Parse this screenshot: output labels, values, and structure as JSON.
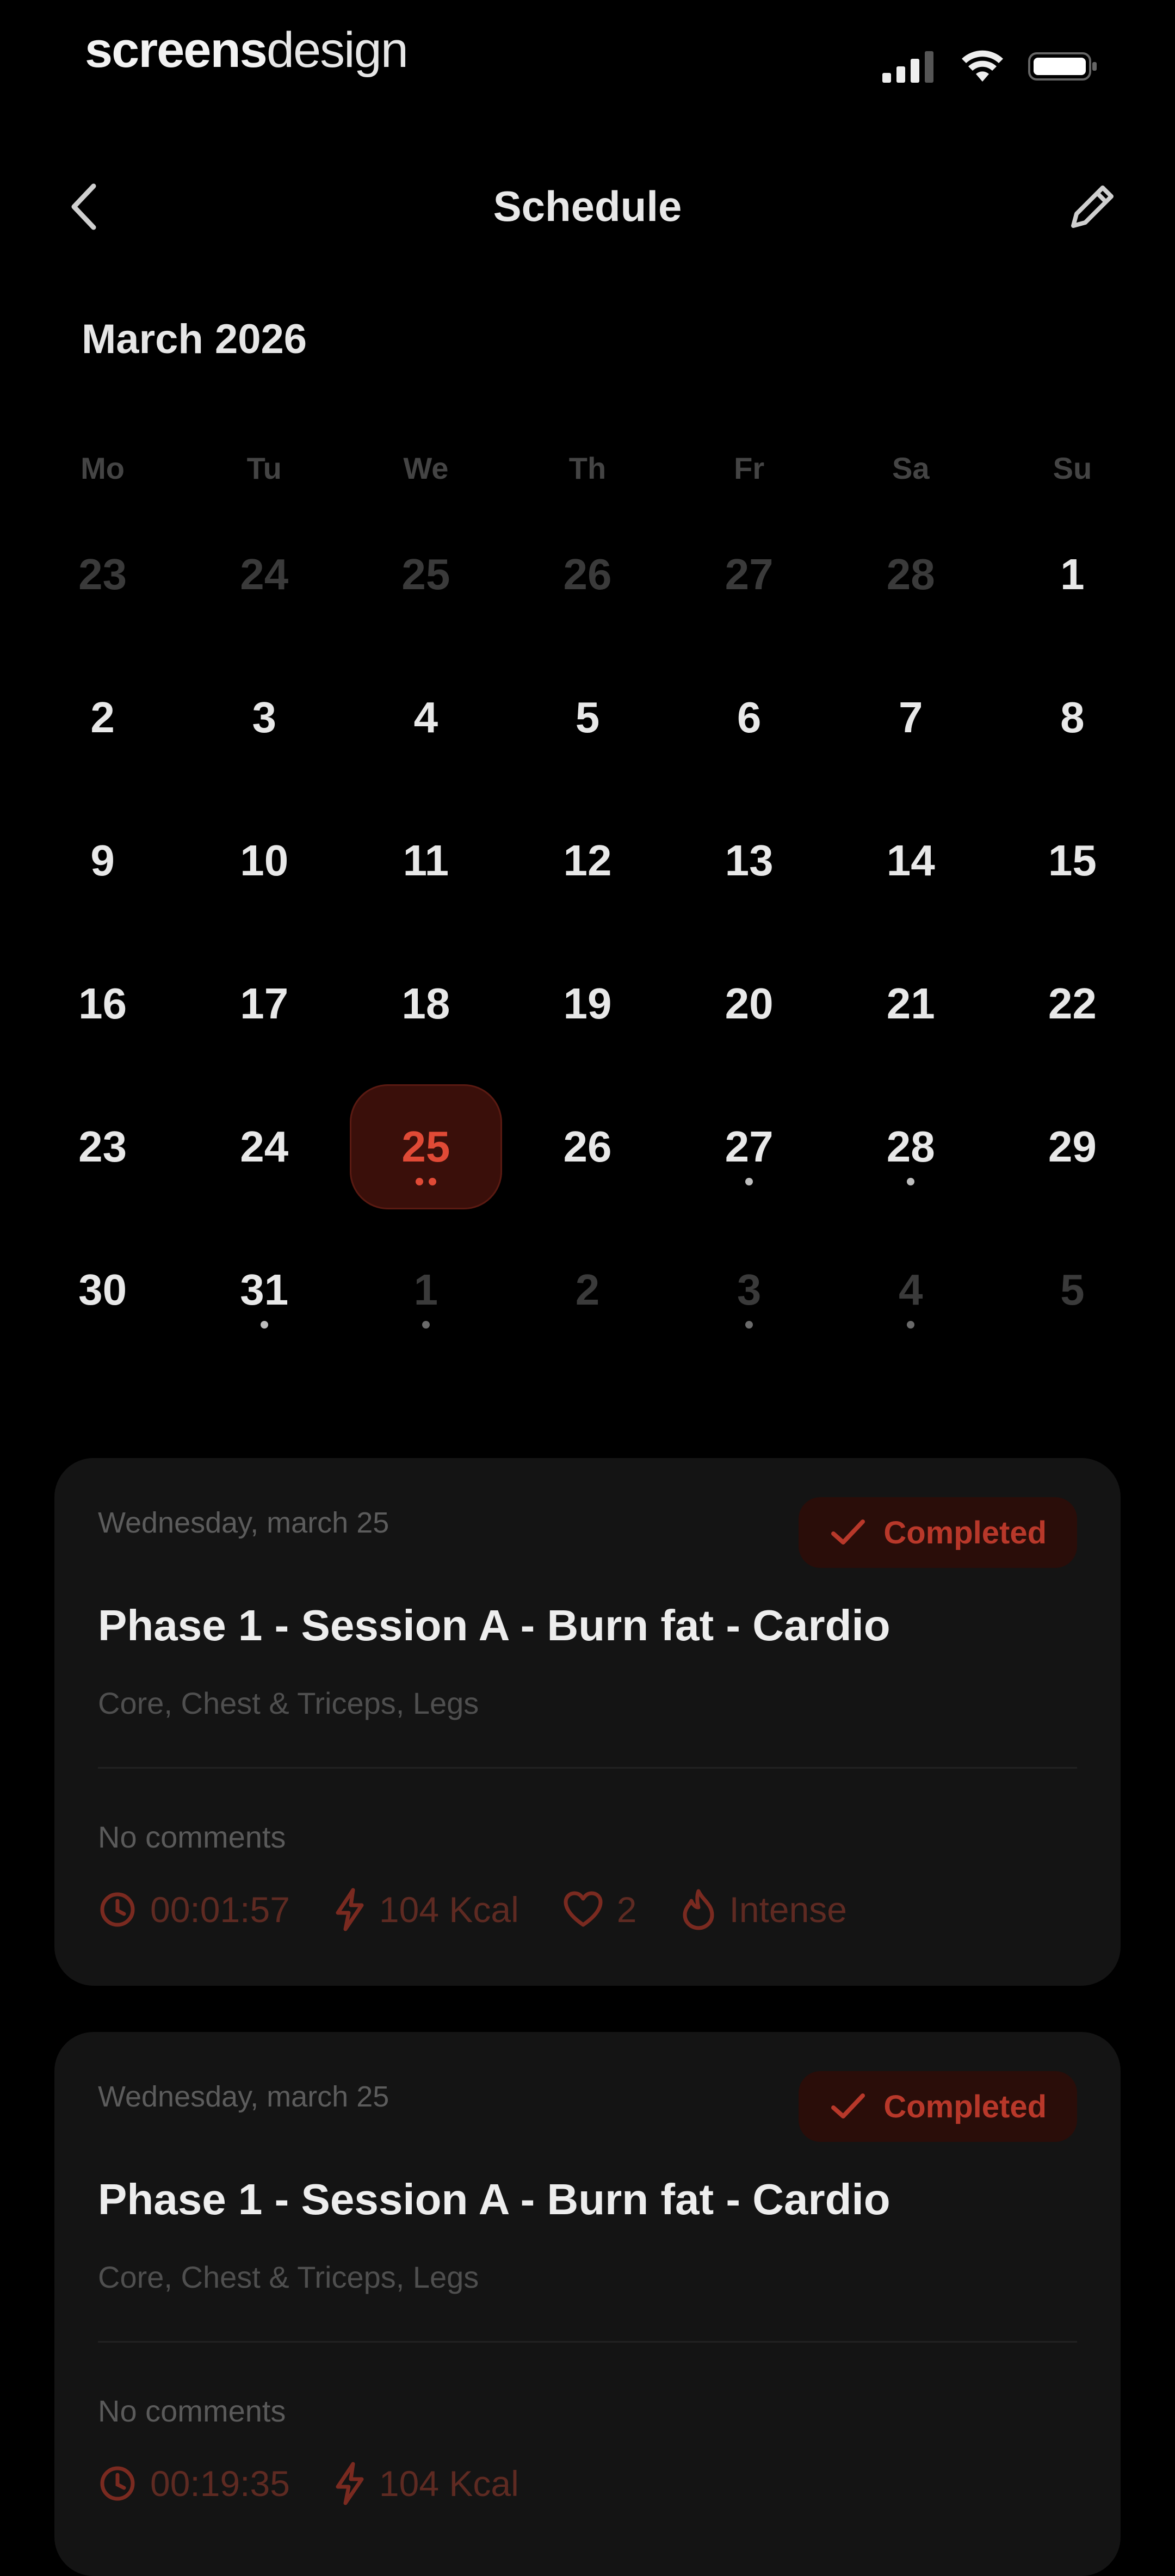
{
  "status_bar": {
    "brand_bold": "screens",
    "brand_light": "design",
    "signal_icon": "signal-icon",
    "wifi_icon": "wifi-icon",
    "battery_icon": "battery-icon"
  },
  "header": {
    "title": "Schedule",
    "back_icon": "chevron-left-icon",
    "edit_icon": "pencil-icon"
  },
  "calendar": {
    "month": "March 2026",
    "weekdays": [
      "Mo",
      "Tu",
      "We",
      "Th",
      "Fr",
      "Sa",
      "Su"
    ],
    "days": [
      {
        "n": "23",
        "muted": true,
        "dots": 0
      },
      {
        "n": "24",
        "muted": true,
        "dots": 0
      },
      {
        "n": "25",
        "muted": true,
        "dots": 0
      },
      {
        "n": "26",
        "muted": true,
        "dots": 0
      },
      {
        "n": "27",
        "muted": true,
        "dots": 0
      },
      {
        "n": "28",
        "muted": true,
        "dots": 0
      },
      {
        "n": "1",
        "muted": false,
        "dots": 0
      },
      {
        "n": "2",
        "muted": false,
        "dots": 0
      },
      {
        "n": "3",
        "muted": false,
        "dots": 0
      },
      {
        "n": "4",
        "muted": false,
        "dots": 0
      },
      {
        "n": "5",
        "muted": false,
        "dots": 0
      },
      {
        "n": "6",
        "muted": false,
        "dots": 0
      },
      {
        "n": "7",
        "muted": false,
        "dots": 0
      },
      {
        "n": "8",
        "muted": false,
        "dots": 0
      },
      {
        "n": "9",
        "muted": false,
        "dots": 0
      },
      {
        "n": "10",
        "muted": false,
        "dots": 0
      },
      {
        "n": "11",
        "muted": false,
        "dots": 0
      },
      {
        "n": "12",
        "muted": false,
        "dots": 0
      },
      {
        "n": "13",
        "muted": false,
        "dots": 0
      },
      {
        "n": "14",
        "muted": false,
        "dots": 0
      },
      {
        "n": "15",
        "muted": false,
        "dots": 0
      },
      {
        "n": "16",
        "muted": false,
        "dots": 0
      },
      {
        "n": "17",
        "muted": false,
        "dots": 0
      },
      {
        "n": "18",
        "muted": false,
        "dots": 0
      },
      {
        "n": "19",
        "muted": false,
        "dots": 0
      },
      {
        "n": "20",
        "muted": false,
        "dots": 0
      },
      {
        "n": "21",
        "muted": false,
        "dots": 0
      },
      {
        "n": "22",
        "muted": false,
        "dots": 0
      },
      {
        "n": "23",
        "muted": false,
        "dots": 0
      },
      {
        "n": "24",
        "muted": false,
        "dots": 0
      },
      {
        "n": "25",
        "muted": false,
        "dots": 2,
        "selected": true
      },
      {
        "n": "26",
        "muted": false,
        "dots": 0
      },
      {
        "n": "27",
        "muted": false,
        "dots": 1
      },
      {
        "n": "28",
        "muted": false,
        "dots": 1
      },
      {
        "n": "29",
        "muted": false,
        "dots": 0
      },
      {
        "n": "30",
        "muted": false,
        "dots": 0
      },
      {
        "n": "31",
        "muted": false,
        "dots": 1
      },
      {
        "n": "1",
        "muted": true,
        "dots": 1
      },
      {
        "n": "2",
        "muted": true,
        "dots": 0
      },
      {
        "n": "3",
        "muted": true,
        "dots": 1
      },
      {
        "n": "4",
        "muted": true,
        "dots": 1
      },
      {
        "n": "5",
        "muted": true,
        "dots": 0
      }
    ]
  },
  "sessions": [
    {
      "date": "Wednesday, march 25",
      "status": "Completed",
      "title": "Phase 1 - Session A - Burn fat - Cardio",
      "muscles": "Core, Chest & Triceps, Legs",
      "comments": "No comments",
      "duration": "00:01:57",
      "calories": "104 Kcal",
      "hearts": "2",
      "intensity": "Intense"
    },
    {
      "date": "Wednesday, march 25",
      "status": "Completed",
      "title": "Phase 1 - Session A - Burn fat - Cardio",
      "muscles": "Core, Chest & Triceps, Legs",
      "comments": "No comments",
      "duration": "00:19:35",
      "calories": "104 Kcal"
    }
  ],
  "colors": {
    "accent": "#e04a36",
    "background": "#000000",
    "card": "#141414"
  }
}
